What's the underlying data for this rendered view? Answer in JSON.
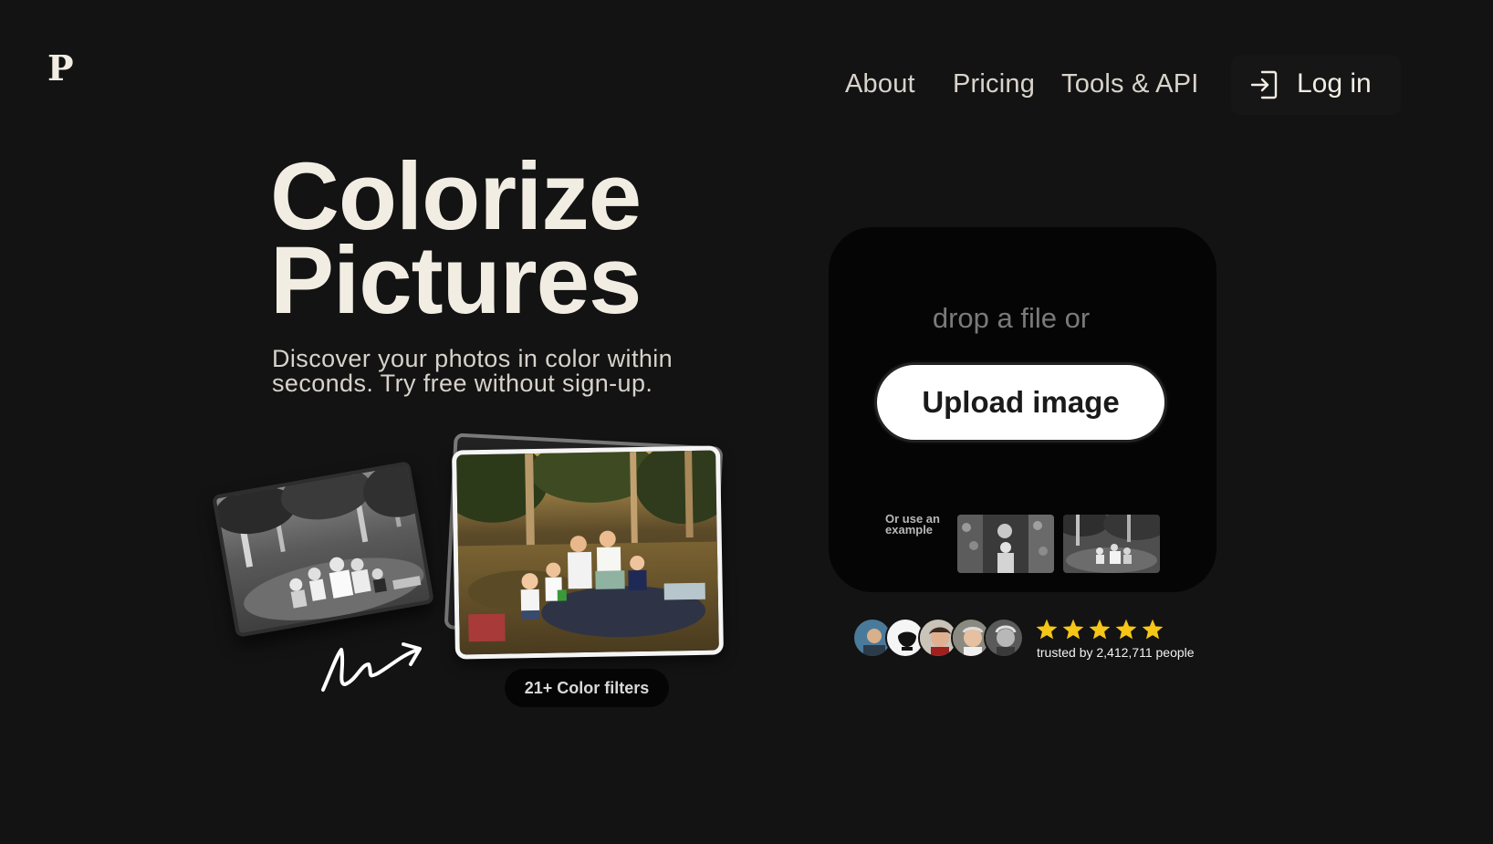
{
  "brand": {
    "logo_text": "P"
  },
  "nav": {
    "about": "About",
    "pricing": "Pricing",
    "tools": "Tools & API",
    "login": "Log in"
  },
  "hero": {
    "title_line1": "Colorize",
    "title_line2": "Pictures",
    "subtitle": "Discover your photos in color within seconds. Try free without sign-up.",
    "filters_badge": "21+ Color filters"
  },
  "upload": {
    "drop_text": "drop a file or",
    "button_label": "Upload image",
    "example_label": "Or use an example"
  },
  "social_proof": {
    "rating_stars": 5,
    "trusted_text": "trusted by 2,412,711 people"
  },
  "colors": {
    "background": "#131313",
    "text_cream": "#f2ede3",
    "card": "#050505",
    "star": "#f5c518"
  }
}
